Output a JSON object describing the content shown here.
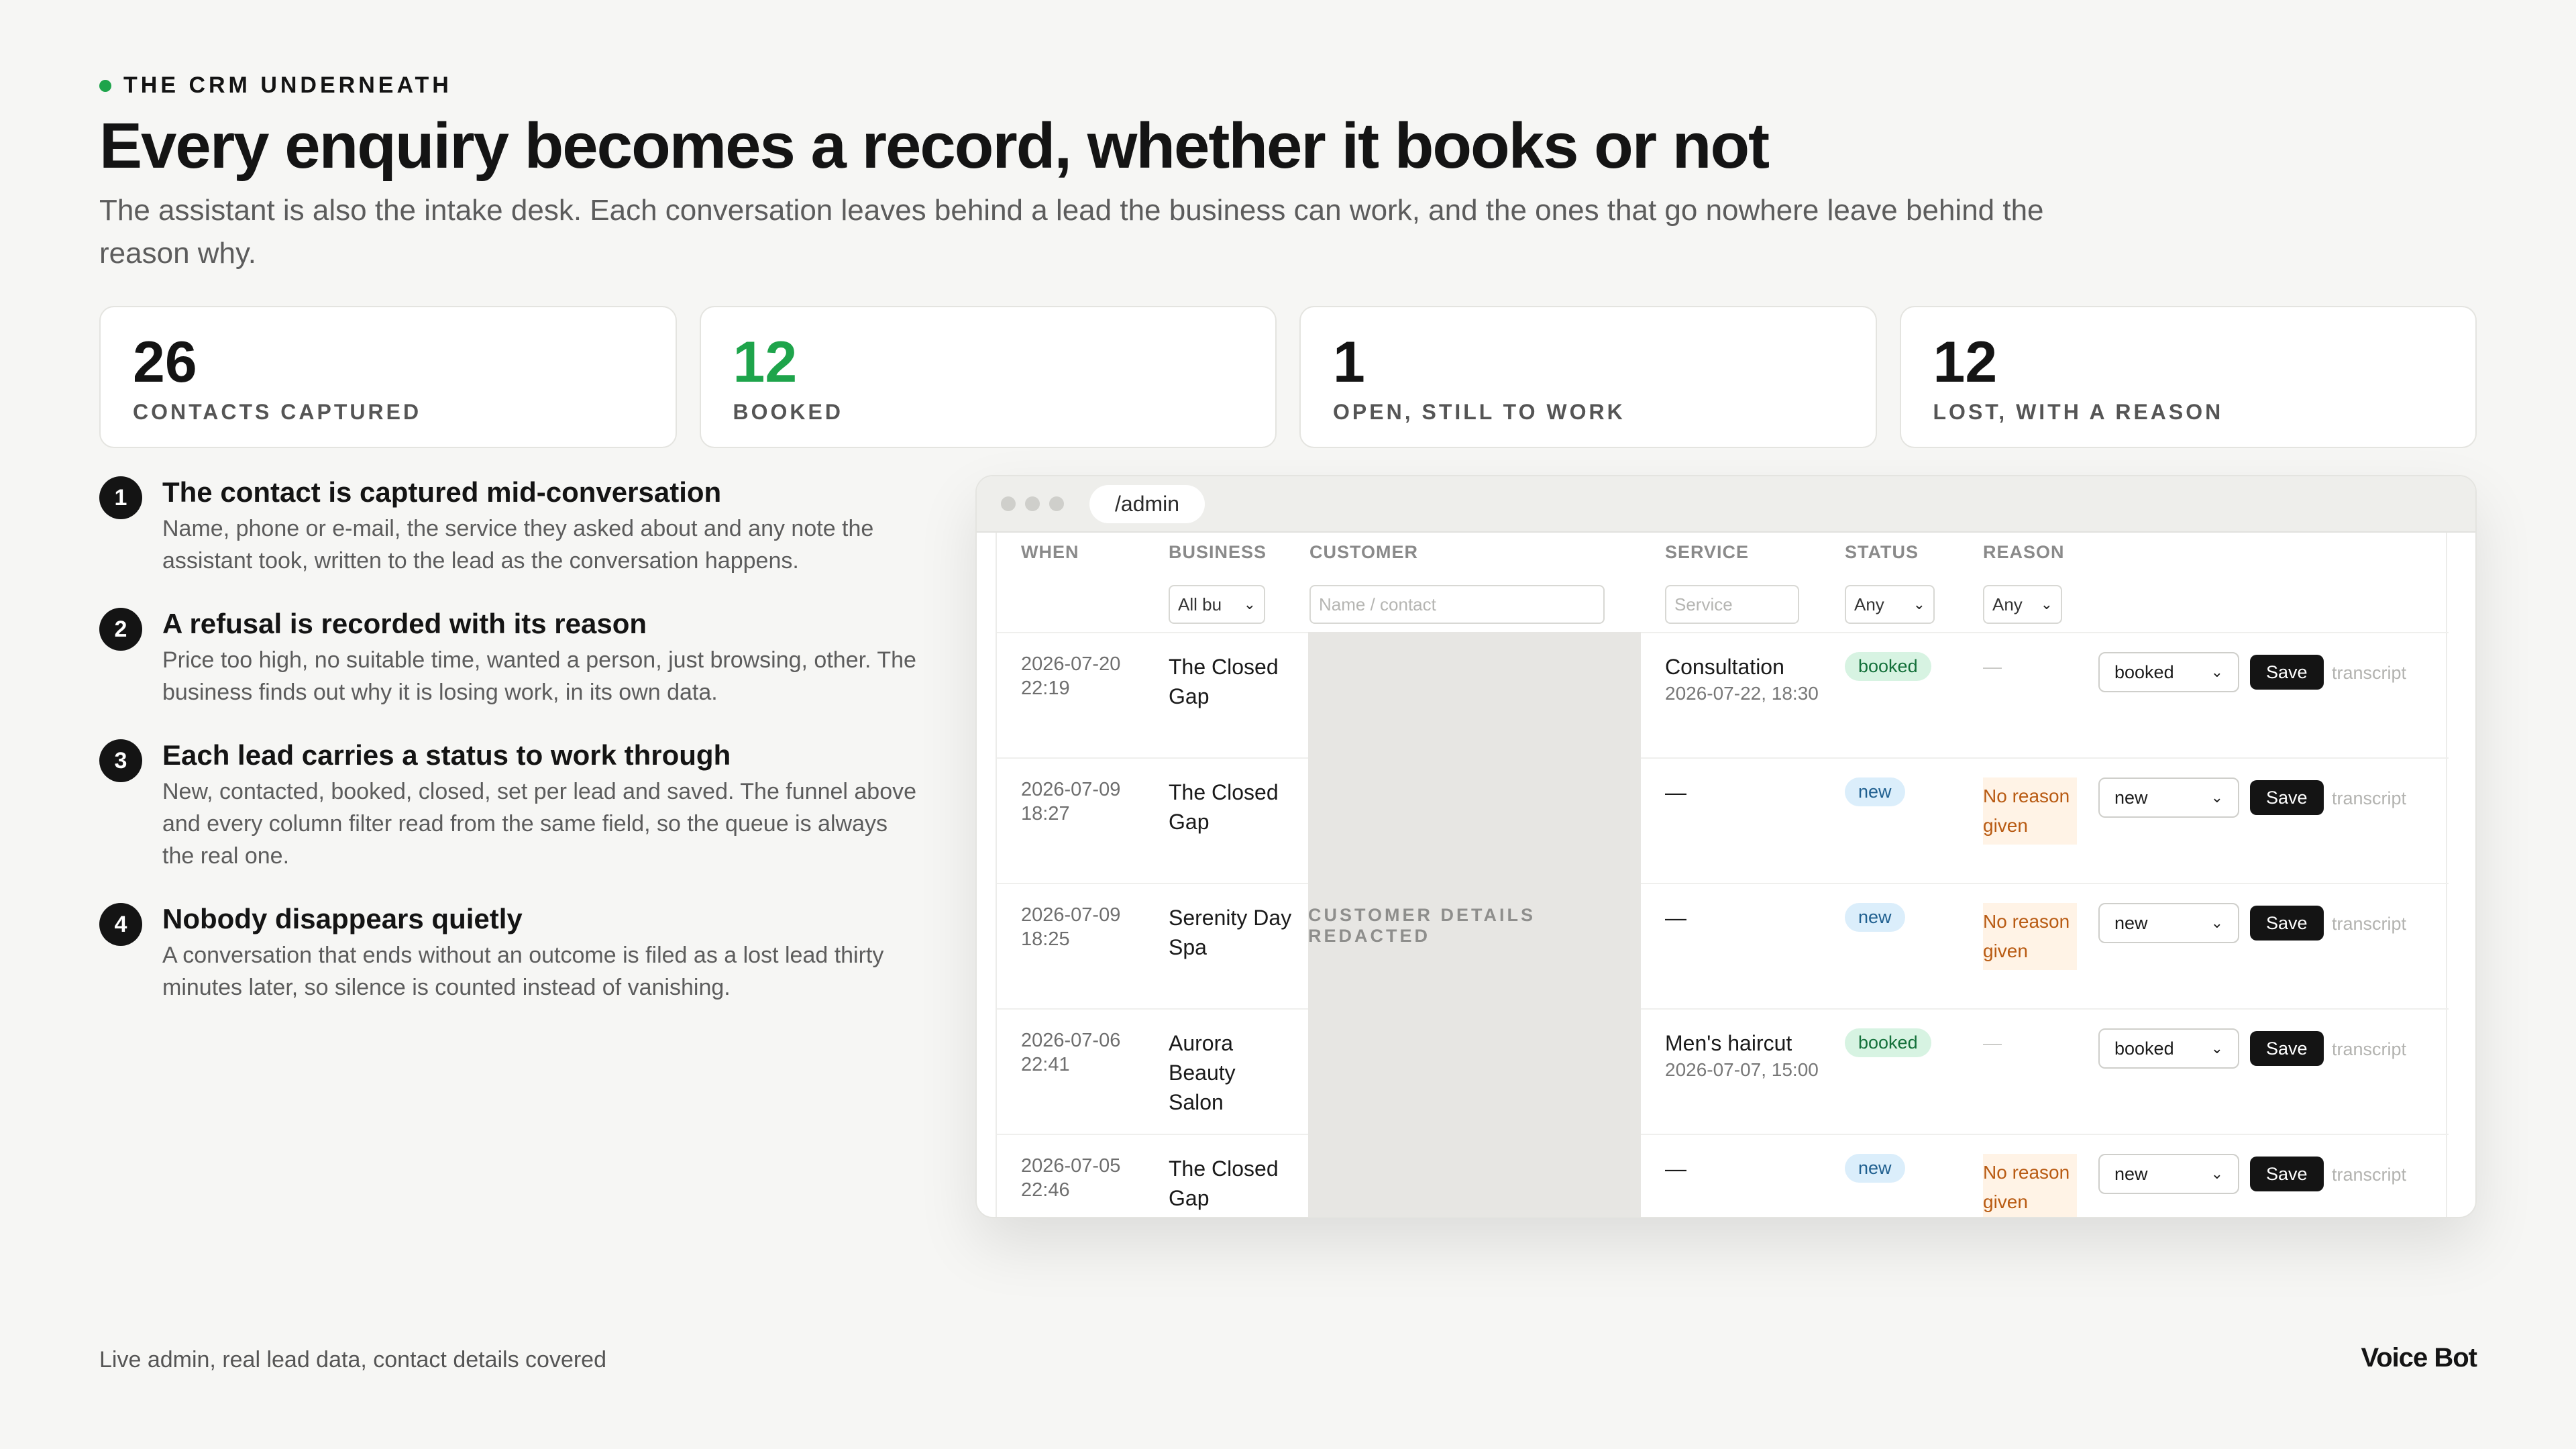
{
  "header": {
    "eyebrow": "THE CRM UNDERNEATH",
    "title": "Every enquiry becomes a record, whether it books or not",
    "subtitle": "The assistant is also the intake desk. Each conversation leaves behind a lead the business can work, and the ones that go nowhere leave behind the reason why."
  },
  "stats": [
    {
      "value": "26",
      "label": "CONTACTS CAPTURED"
    },
    {
      "value": "12",
      "label": "BOOKED",
      "color": "#1ea44b"
    },
    {
      "value": "1",
      "label": "OPEN, STILL TO WORK"
    },
    {
      "value": "12",
      "label": "LOST, WITH A REASON"
    }
  ],
  "steps": [
    {
      "num": "1",
      "title": "The contact is captured mid-conversation",
      "body": "Name, phone or e-mail, the service they asked about and any note the assistant took, written to the lead as the conversation happens."
    },
    {
      "num": "2",
      "title": "A refusal is recorded with its reason",
      "body": "Price too high, no suitable time, wanted a person, just browsing, other. The business finds out why it is losing work, in its own data."
    },
    {
      "num": "3",
      "title": "Each lead carries a status to work through",
      "body": "New, contacted, booked, closed, set per lead and saved. The funnel above and every column filter read from the same field, so the queue is always the real one."
    },
    {
      "num": "4",
      "title": "Nobody disappears quietly",
      "body": "A conversation that ends without an outcome is filed as a lost lead thirty minutes later, so silence is counted instead of vanishing."
    }
  ],
  "window": {
    "url": "/admin",
    "columns": {
      "when": "WHEN",
      "business": "BUSINESS",
      "customer": "CUSTOMER",
      "service": "SERVICE",
      "status": "STATUS",
      "reason": "REASON"
    },
    "filters": {
      "business": "All bu",
      "customer_placeholder": "Name / contact",
      "service_placeholder": "Service",
      "status": "Any",
      "reason": "Any"
    },
    "redacted_label": "CUSTOMER DETAILS REDACTED",
    "save_label": "Save",
    "transcript_label": "transcript",
    "rows": [
      {
        "date": "2026-07-20",
        "time": "22:19",
        "business": "The Closed Gap",
        "service": "Consultation",
        "service_date": "2026-07-22, 18:30",
        "status": "booked",
        "reason": "—",
        "select": "booked"
      },
      {
        "date": "2026-07-09",
        "time": "18:27",
        "business": "The Closed Gap",
        "service": "—",
        "service_date": "",
        "status": "new",
        "reason": "No reason given",
        "select": "new"
      },
      {
        "date": "2026-07-09",
        "time": "18:25",
        "business": "Serenity Day Spa",
        "service": "—",
        "service_date": "",
        "status": "new",
        "reason": "No reason given",
        "select": "new"
      },
      {
        "date": "2026-07-06",
        "time": "22:41",
        "business": "Aurora Beauty Salon",
        "service": "Men's haircut",
        "service_date": "2026-07-07, 15:00",
        "status": "booked",
        "reason": "—",
        "select": "booked"
      },
      {
        "date": "2026-07-05",
        "time": "22:46",
        "business": "The Closed Gap",
        "service": "—",
        "service_date": "",
        "status": "new",
        "reason": "No reason given",
        "select": "new"
      }
    ]
  },
  "footer": {
    "left": "Live admin, real lead data, contact details covered",
    "right": "Voice Bot"
  }
}
